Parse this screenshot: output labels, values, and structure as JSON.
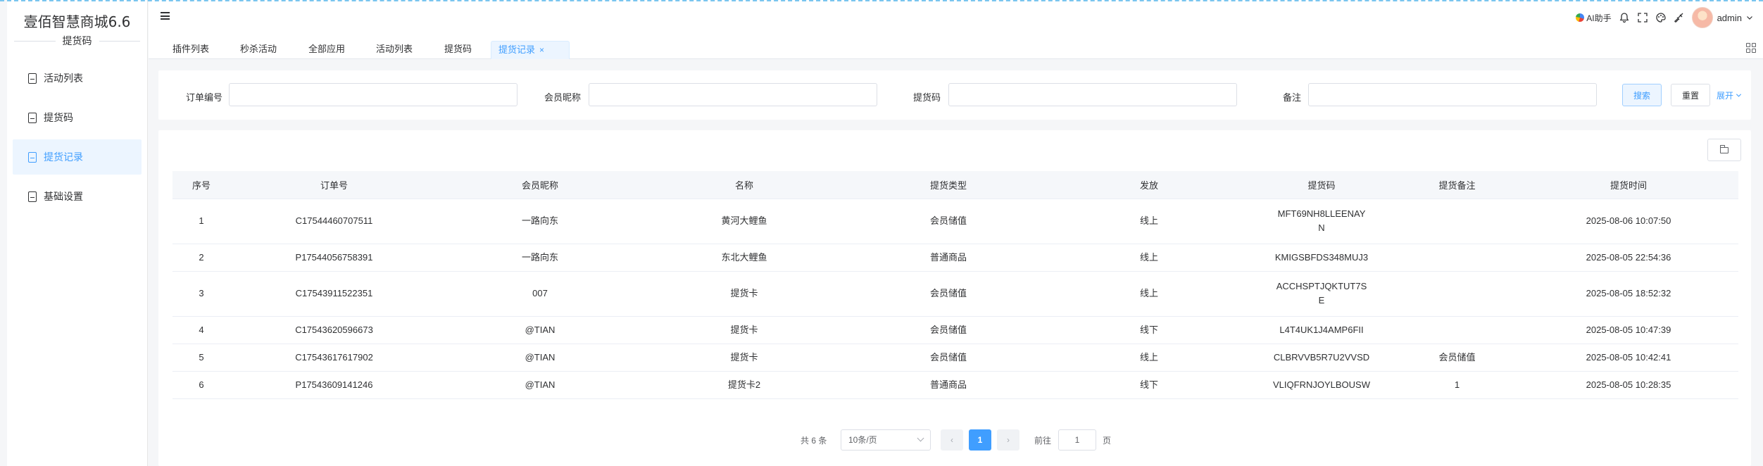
{
  "app": {
    "title": "壹佰智慧商城6.6",
    "section": "提货码"
  },
  "sidebar": {
    "items": [
      {
        "label": "活动列表",
        "icon": "document-icon"
      },
      {
        "label": "提货码",
        "icon": "document-icon"
      },
      {
        "label": "提货记录",
        "icon": "document-icon",
        "active": true
      },
      {
        "label": "基础设置",
        "icon": "document-icon"
      }
    ]
  },
  "header": {
    "menu_icon": "hamburger-icon",
    "ai_label": "AI助手",
    "icons": [
      "bell-icon",
      "fullscreen-icon",
      "palette-icon",
      "brush-icon"
    ],
    "user": "admin"
  },
  "tabs": [
    {
      "label": "插件列表"
    },
    {
      "label": "秒杀活动"
    },
    {
      "label": "全部应用"
    },
    {
      "label": "活动列表"
    },
    {
      "label": "提货码"
    },
    {
      "label": "提货记录",
      "active": true,
      "close": "×"
    }
  ],
  "search": {
    "fields": [
      {
        "label": "订单编号",
        "value": ""
      },
      {
        "label": "会员昵称",
        "value": ""
      },
      {
        "label": "提货码",
        "value": ""
      },
      {
        "label": "备注",
        "value": ""
      }
    ],
    "search_label": "搜索",
    "reset_label": "重置",
    "expand_label": "展开"
  },
  "table": {
    "columns": [
      "序号",
      "订单号",
      "会员昵称",
      "名称",
      "提货类型",
      "发放",
      "提货码",
      "提货备注",
      "提货时间"
    ],
    "rows": [
      [
        "1",
        "C17544460707511",
        "一路向东",
        "黄河大鲤鱼",
        "会员储值",
        "线上",
        "MFT69NH8LLEENAYN",
        "",
        "2025-08-06 10:07:50"
      ],
      [
        "2",
        "P17544056758391",
        "一路向东",
        "东北大鲤鱼",
        "普通商品",
        "线上",
        "KMIGSBFDS348MUJ3",
        "",
        "2025-08-05 22:54:36"
      ],
      [
        "3",
        "C17543911522351",
        "007",
        "提货卡",
        "会员储值",
        "线上",
        "ACCHSPTJQKTUT7SE",
        "",
        "2025-08-05 18:52:32"
      ],
      [
        "4",
        "C17543620596673",
        "@TIAN",
        "提货卡",
        "会员储值",
        "线下",
        "L4T4UK1J4AMP6FII",
        "",
        "2025-08-05 10:47:39"
      ],
      [
        "5",
        "C17543617617902",
        "@TIAN",
        "提货卡",
        "会员储值",
        "线上",
        "CLBRVVB5R7U2VVSD",
        "会员储值",
        "2025-08-05 10:42:41"
      ],
      [
        "6",
        "P17543609141246",
        "@TIAN",
        "提货卡2",
        "普通商品",
        "线下",
        "VLIQFRNJOYLBOUSW",
        "1",
        "2025-08-05 10:28:35"
      ]
    ]
  },
  "pagination": {
    "total": "共 6 条",
    "page_size": "10条/页",
    "prev": "‹",
    "current": "1",
    "next": "›",
    "goto_label": "前往",
    "goto_value": "1",
    "page_unit": "页"
  },
  "colors": {
    "primary": "#409eff",
    "active_bg": "#ecf5ff",
    "header_bg": "#f5f7fa"
  }
}
